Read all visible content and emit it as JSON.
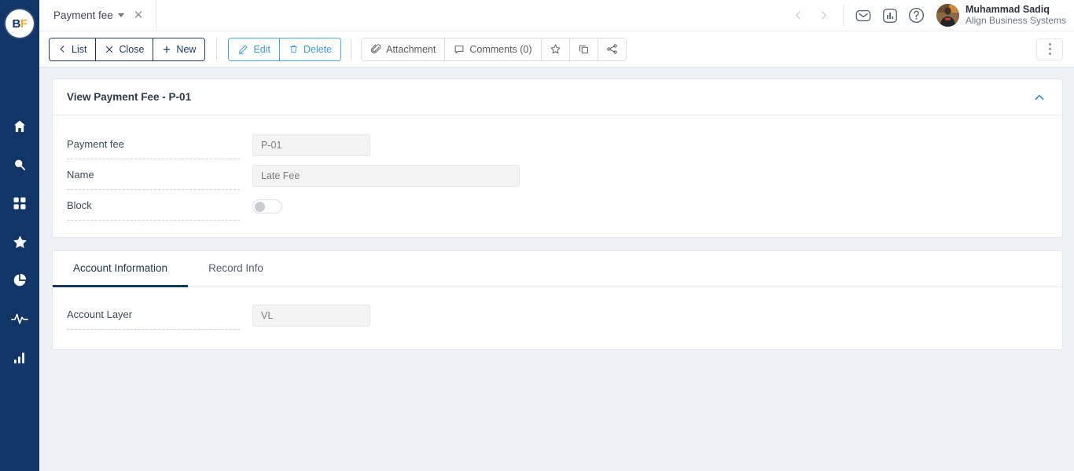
{
  "brand": {
    "logo_b": "B",
    "logo_f": "F",
    "navy": "#123567",
    "accent_orange": "#f0a830",
    "accent_blue": "#3d9ad8"
  },
  "sidebar": {
    "items": [
      {
        "icon": "home-icon",
        "label": "Home"
      },
      {
        "icon": "search-icon",
        "label": "Search"
      },
      {
        "icon": "apps-grid-icon",
        "label": "Apps"
      },
      {
        "icon": "star-icon",
        "label": "Favorites"
      },
      {
        "icon": "pie-chart-icon",
        "label": "Reports"
      },
      {
        "icon": "activity-pulse-icon",
        "label": "Activity"
      },
      {
        "icon": "bar-chart-icon",
        "label": "Analytics"
      }
    ]
  },
  "header": {
    "tab": {
      "label": "Payment fee",
      "caret_icon": "chevron-down-icon",
      "close_icon": "close-icon"
    },
    "nav_back_icon": "chevron-left-icon",
    "nav_forward_icon": "chevron-right-icon",
    "icons": [
      {
        "name": "mail-icon"
      },
      {
        "name": "reports-chart-icon"
      },
      {
        "name": "help-icon"
      }
    ],
    "user": {
      "name": "Muhammad Sadiq",
      "organization": "Align Business Systems",
      "avatar": "user-avatar"
    }
  },
  "toolbar": {
    "group_nav": [
      {
        "label": "List",
        "icon": "chevron-left-icon"
      },
      {
        "label": "Close",
        "icon": "close-icon"
      },
      {
        "label": "New",
        "icon": "plus-icon"
      }
    ],
    "group_edit": [
      {
        "label": "Edit",
        "icon": "pencil-icon"
      },
      {
        "label": "Delete",
        "icon": "trash-icon"
      }
    ],
    "group_actions": [
      {
        "label": "Attachment",
        "icon": "paperclip-icon"
      },
      {
        "label": "Comments (0)",
        "icon": "comment-icon"
      }
    ],
    "icon_buttons": [
      {
        "name": "star-icon"
      },
      {
        "name": "duplicate-icon"
      },
      {
        "name": "share-icon"
      }
    ],
    "overflow_icon": "kebab-menu-icon"
  },
  "main": {
    "card": {
      "title": "View Payment Fee - P-01",
      "collapse_icon": "chevron-up-icon",
      "fields": [
        {
          "label": "Payment fee",
          "value": "P-01",
          "type": "text",
          "width": "w150"
        },
        {
          "label": "Name",
          "value": "Late Fee",
          "type": "text",
          "width": "w340"
        },
        {
          "label": "Block",
          "value": "",
          "type": "toggle",
          "checked": false
        }
      ]
    },
    "tabs": [
      {
        "label": "Account Information",
        "active": true
      },
      {
        "label": "Record Info",
        "active": false
      }
    ],
    "tab_fields": [
      {
        "label": "Account Layer",
        "value": "VL",
        "type": "text",
        "width": "w150"
      }
    ]
  }
}
